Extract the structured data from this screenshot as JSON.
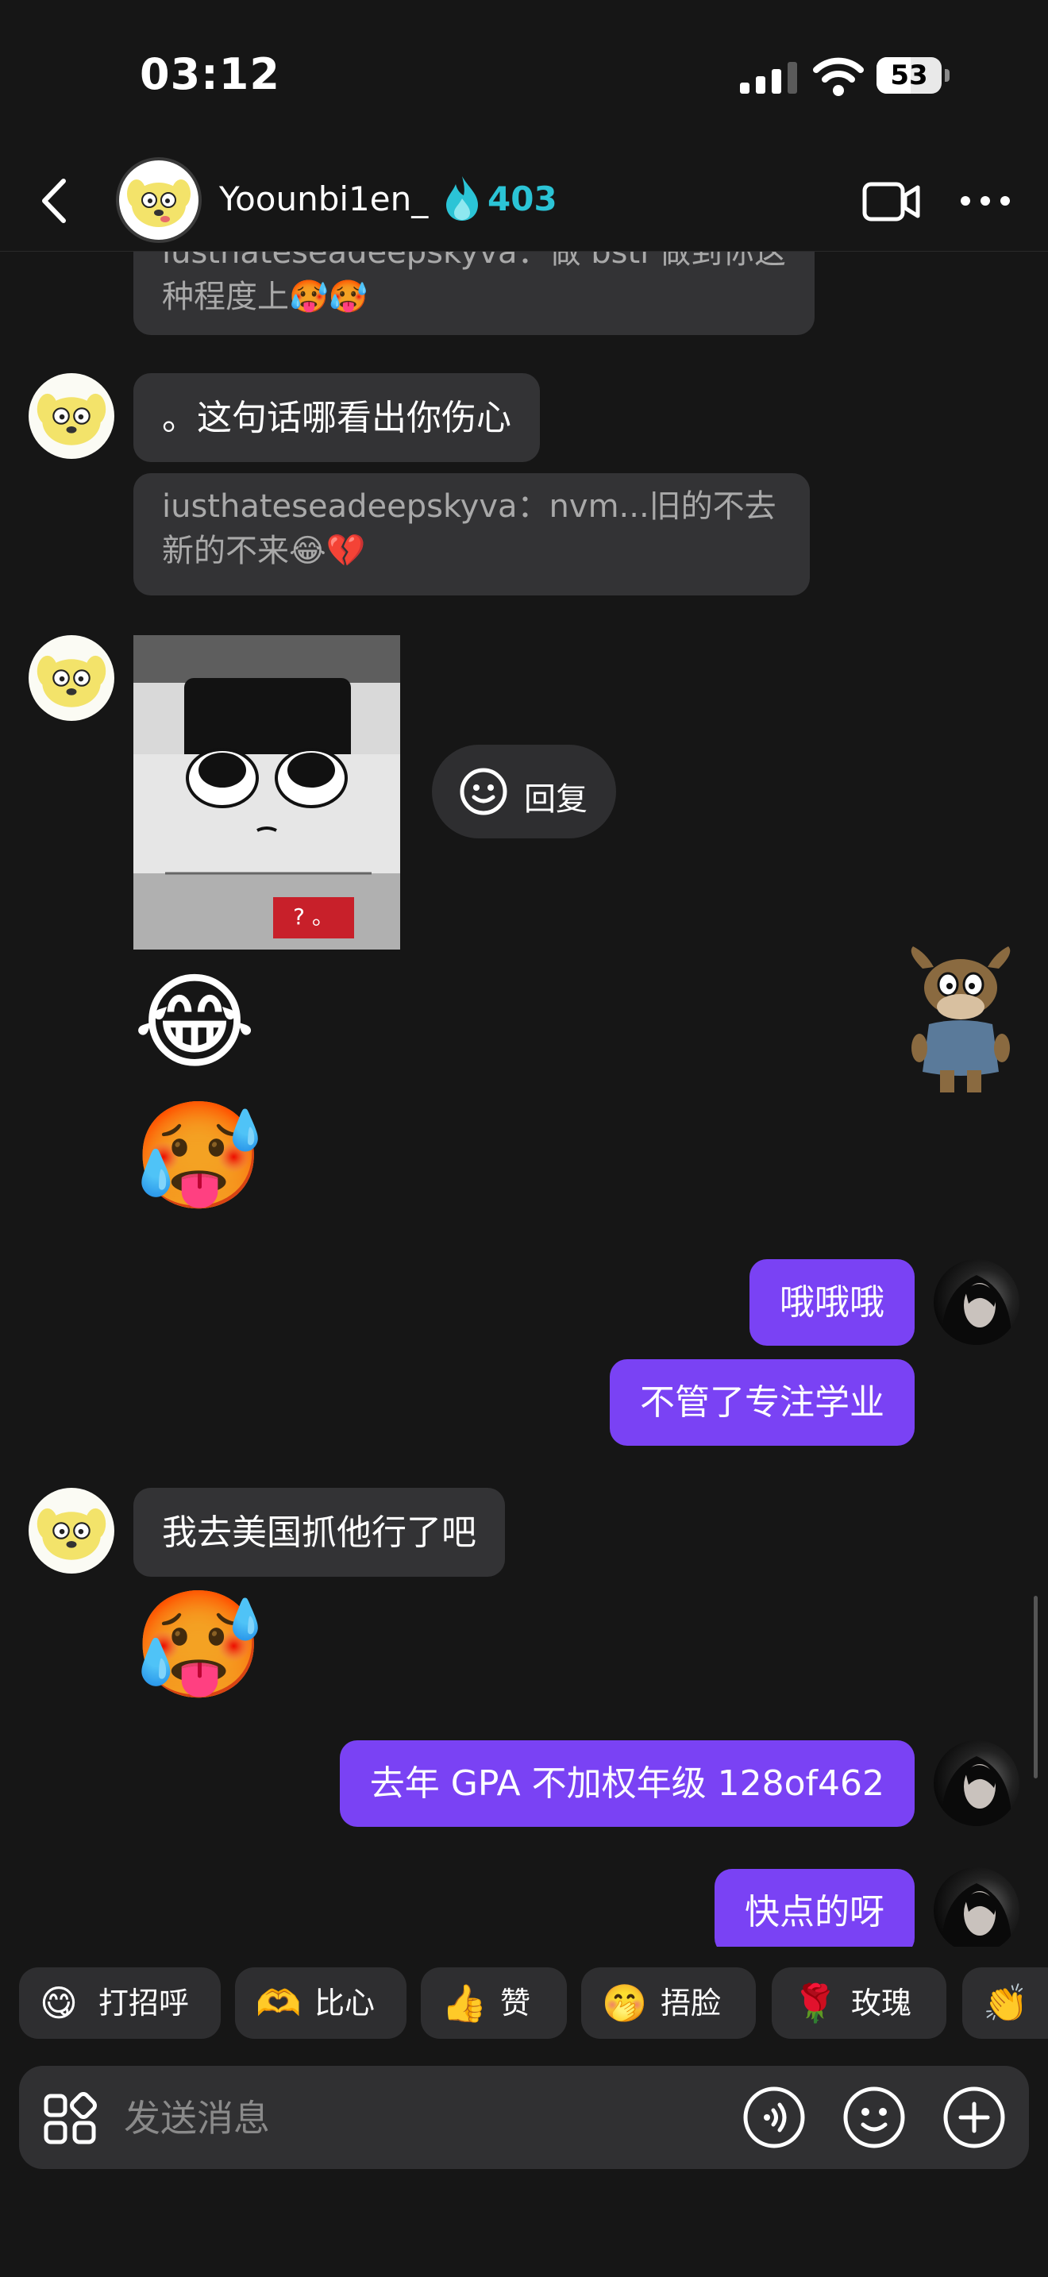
{
  "status_bar": {
    "time": "03:12",
    "battery": "53",
    "battery_level": 0.53
  },
  "header": {
    "username": "Yoounbi1en_",
    "streak_count": "403"
  },
  "messages": {
    "quote_top": "iusthateseadeepskyva：做 bstl 做到你这\n种程度上🥵🥵",
    "m1": "。这句话哪看出你伤心",
    "quote_mid": "iusthateseadeepskyva：nvm...旧的不去\n新的不来😂💔",
    "image_caption": "? 。",
    "reply_label": "回复",
    "emoji_1": "😂",
    "emoji_2": "🥵",
    "sent_1": "哦哦哦",
    "sent_2": "不管了专注学业",
    "m2": "我去美国抓他行了吧",
    "emoji_3": "🥵",
    "sent_3": "去年 GPA 不加权年级 128of462",
    "sent_4": "快点的呀"
  },
  "quick_replies": [
    {
      "emoji": "😋",
      "label": "打招呼"
    },
    {
      "emoji": "🫶",
      "label": "比心"
    },
    {
      "emoji": "👍",
      "label": "赞"
    },
    {
      "emoji": "🤭",
      "label": "捂脸"
    },
    {
      "emoji": "🌹",
      "label": "玫瑰"
    },
    {
      "emoji": "👏",
      "label": ""
    }
  ],
  "input": {
    "placeholder": "发送消息"
  },
  "colors": {
    "accent": "#7a42f4",
    "streak": "#2bc4d6",
    "background": "#161616",
    "bubble": "#333335"
  },
  "icons": [
    "back-icon",
    "flame-icon",
    "video-call-icon",
    "more-icon",
    "smile-icon",
    "grid-icon",
    "voice-icon",
    "emoji-icon",
    "plus-icon"
  ]
}
